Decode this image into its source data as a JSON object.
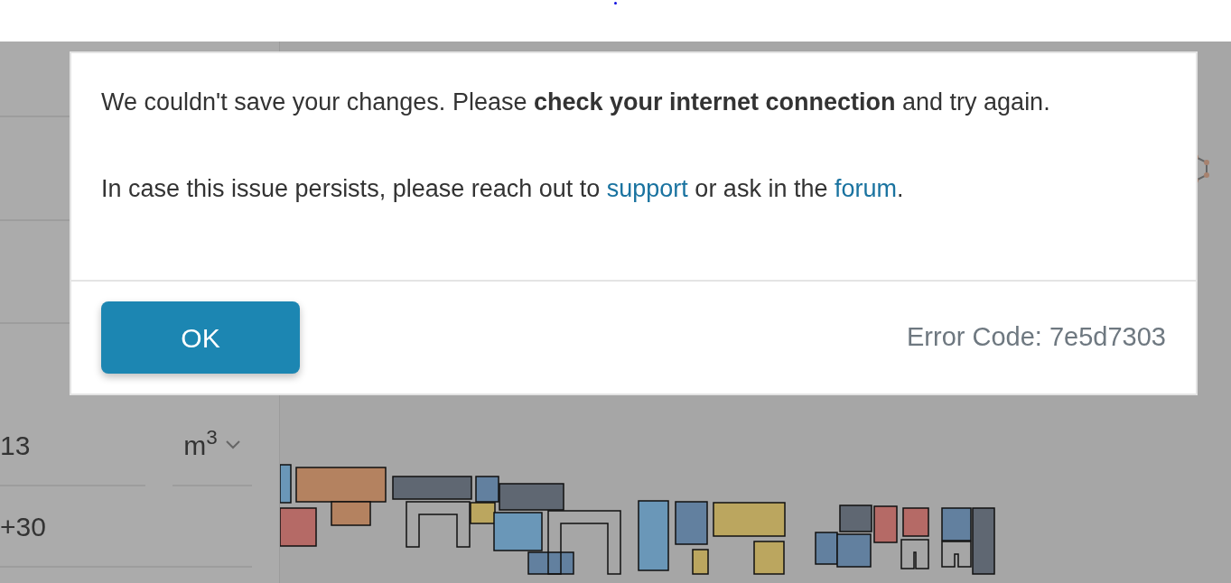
{
  "panel": {
    "volume_value": "13",
    "unit": "m$^{3}$",
    "offset_value": "+30"
  },
  "dialog": {
    "message": "We couldn't save your changes. Please **check your internet connection** and try again.",
    "help": {
      "before": "In case this issue persists, please reach out to ",
      "support_link": "support",
      "middle": " or ask in the ",
      "forum_link": "forum",
      "after": "."
    },
    "ok_button": "OK",
    "error_code": "Error Code: 7e5d7303"
  }
}
